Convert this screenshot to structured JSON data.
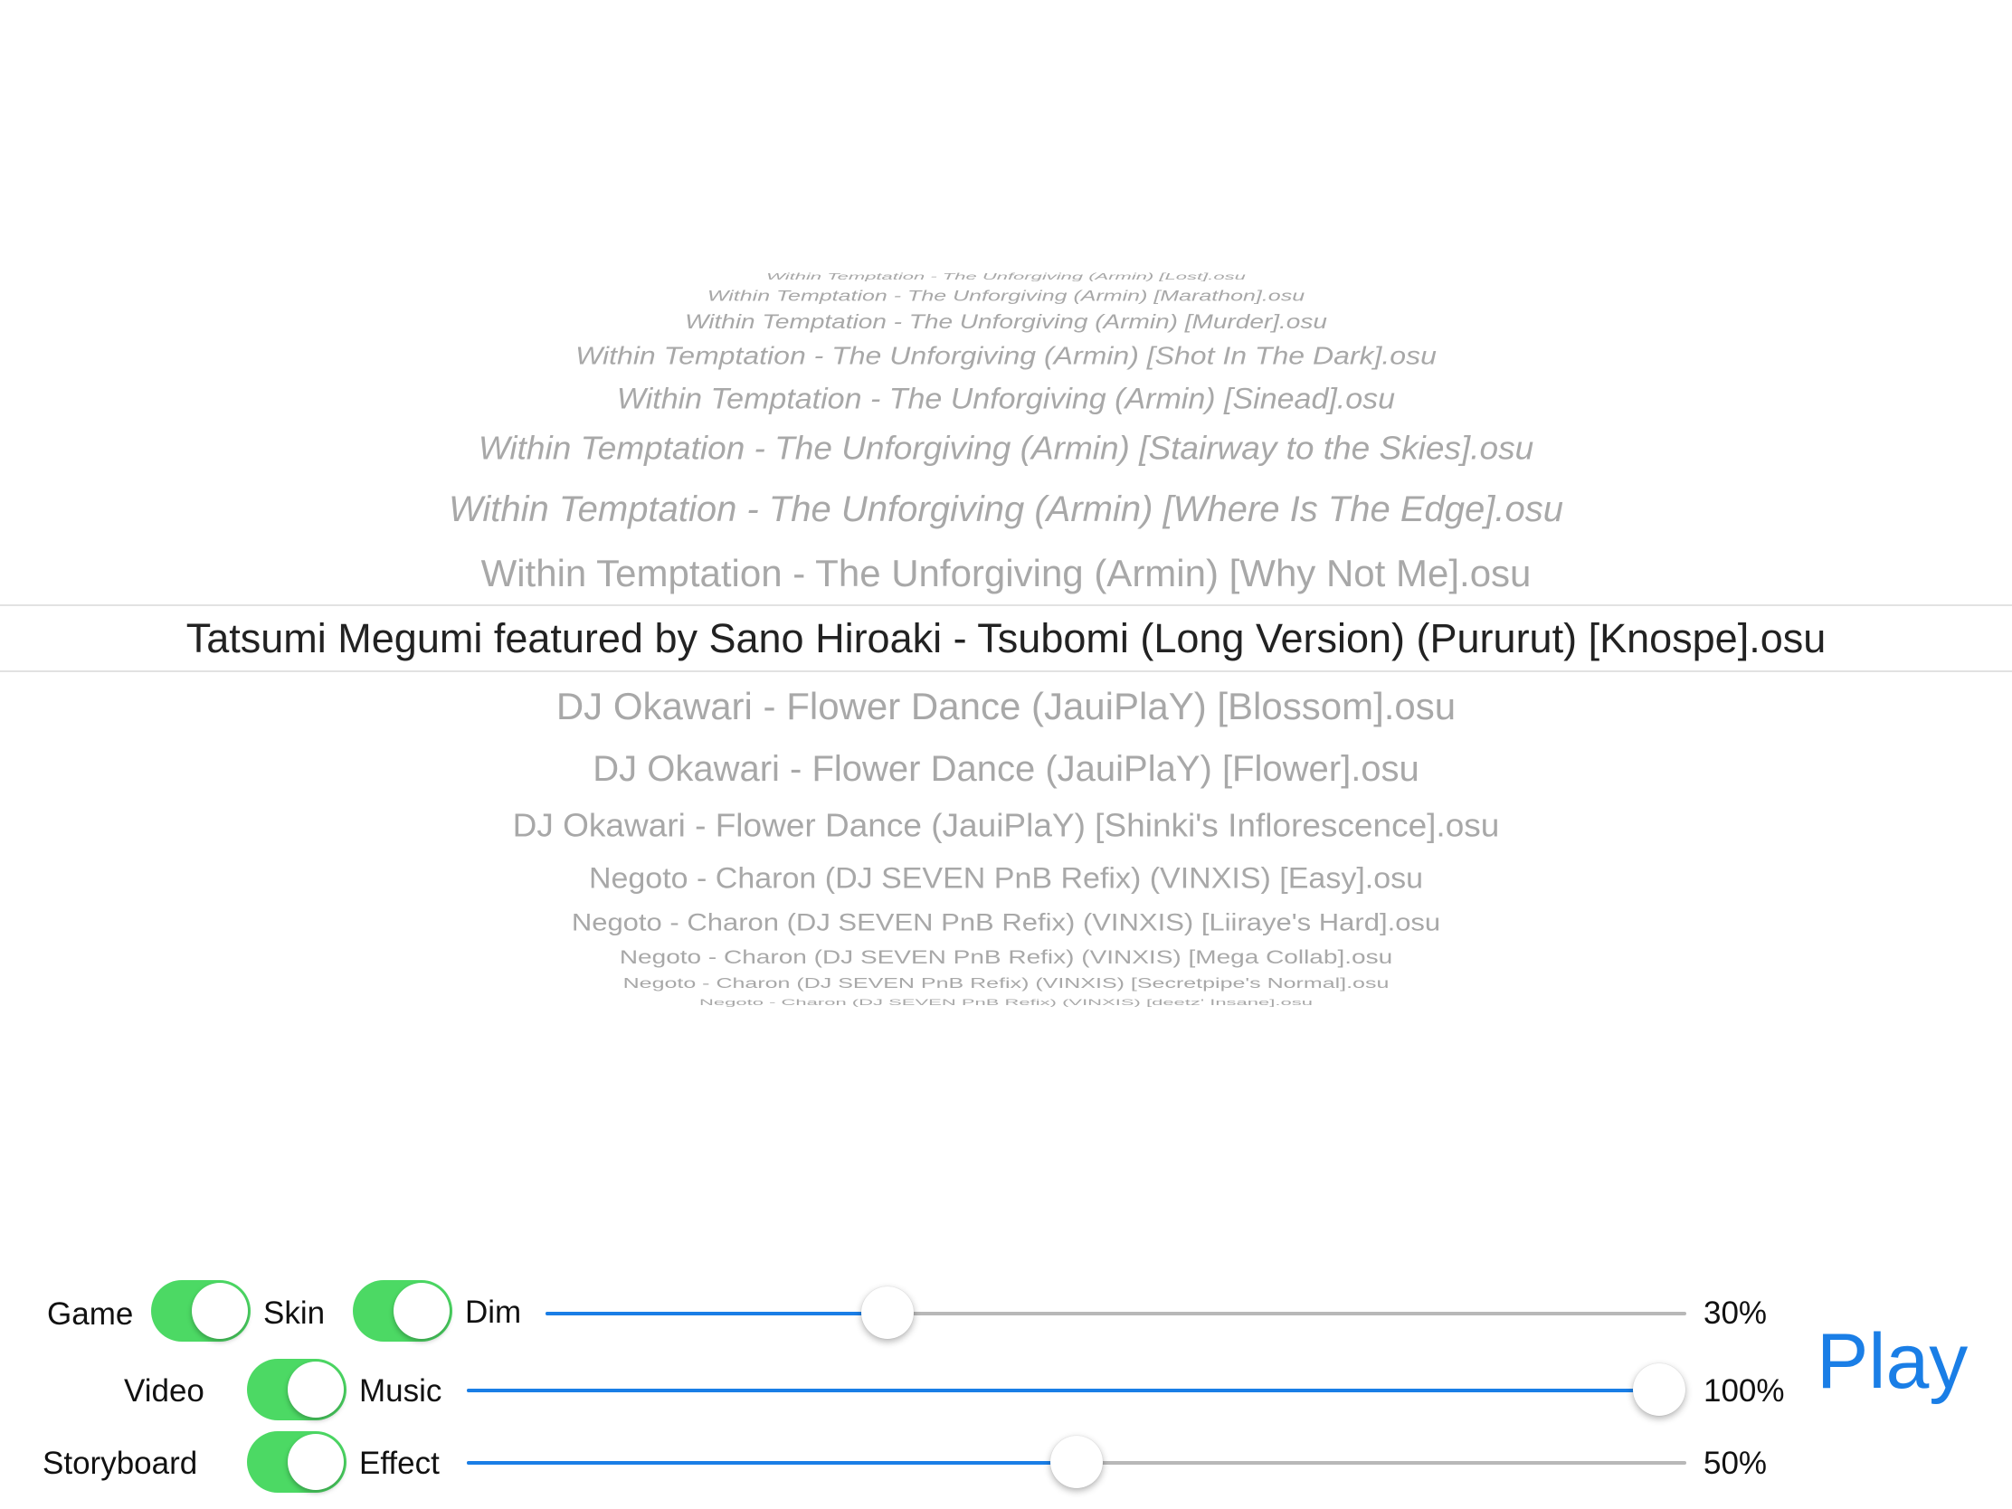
{
  "picker": {
    "above": [
      "Within Temptation - The Unforgiving (Armin) [Lost].osu",
      "Within Temptation - The Unforgiving (Armin) [Marathon].osu",
      "Within Temptation - The Unforgiving (Armin) [Murder].osu",
      "Within Temptation - The Unforgiving (Armin) [Shot In The Dark].osu",
      "Within Temptation - The Unforgiving (Armin) [Sinead].osu",
      "Within Temptation - The Unforgiving (Armin) [Stairway to the Skies].osu",
      "Within Temptation - The Unforgiving (Armin) [Where Is The Edge].osu",
      "Within Temptation - The Unforgiving (Armin) [Why Not Me].osu"
    ],
    "selected": "Tatsumi Megumi featured by Sano Hiroaki - Tsubomi (Long Version) (Pururut) [Knospe].osu",
    "below": [
      "DJ Okawari - Flower Dance (JauiPlaY) [Blossom].osu",
      "DJ Okawari - Flower Dance (JauiPlaY) [Flower].osu",
      "DJ Okawari - Flower Dance (JauiPlaY) [Shinki's Inflorescence].osu",
      "Negoto - Charon (DJ SEVEN PnB Refix) (VINXIS) [Easy].osu",
      "Negoto - Charon (DJ SEVEN PnB Refix) (VINXIS) [Liiraye's Hard].osu",
      "Negoto - Charon (DJ SEVEN PnB Refix) (VINXIS) [Mega Collab].osu",
      "Negoto - Charon (DJ SEVEN PnB Refix) (VINXIS) [Secretpipe's Normal].osu",
      "Negoto - Charon (DJ SEVEN PnB Refix) (VINXIS) [deetz' Insane].osu"
    ]
  },
  "controls": {
    "game": {
      "label": "Game",
      "on": true
    },
    "skin": {
      "label": "Skin",
      "on": true
    },
    "video": {
      "label": "Video",
      "on": true
    },
    "storyboard": {
      "label": "Storyboard",
      "on": true
    },
    "dim": {
      "label": "Dim",
      "value": 0.3,
      "text": "30%"
    },
    "music": {
      "label": "Music",
      "value": 1.0,
      "text": "100%"
    },
    "effect": {
      "label": "Effect",
      "value": 0.5,
      "text": "50%"
    }
  },
  "play_label": "Play",
  "colors": {
    "accent": "#1a7ee6",
    "toggle_on": "#4cd964",
    "dim_text": "#a8a8a8"
  }
}
